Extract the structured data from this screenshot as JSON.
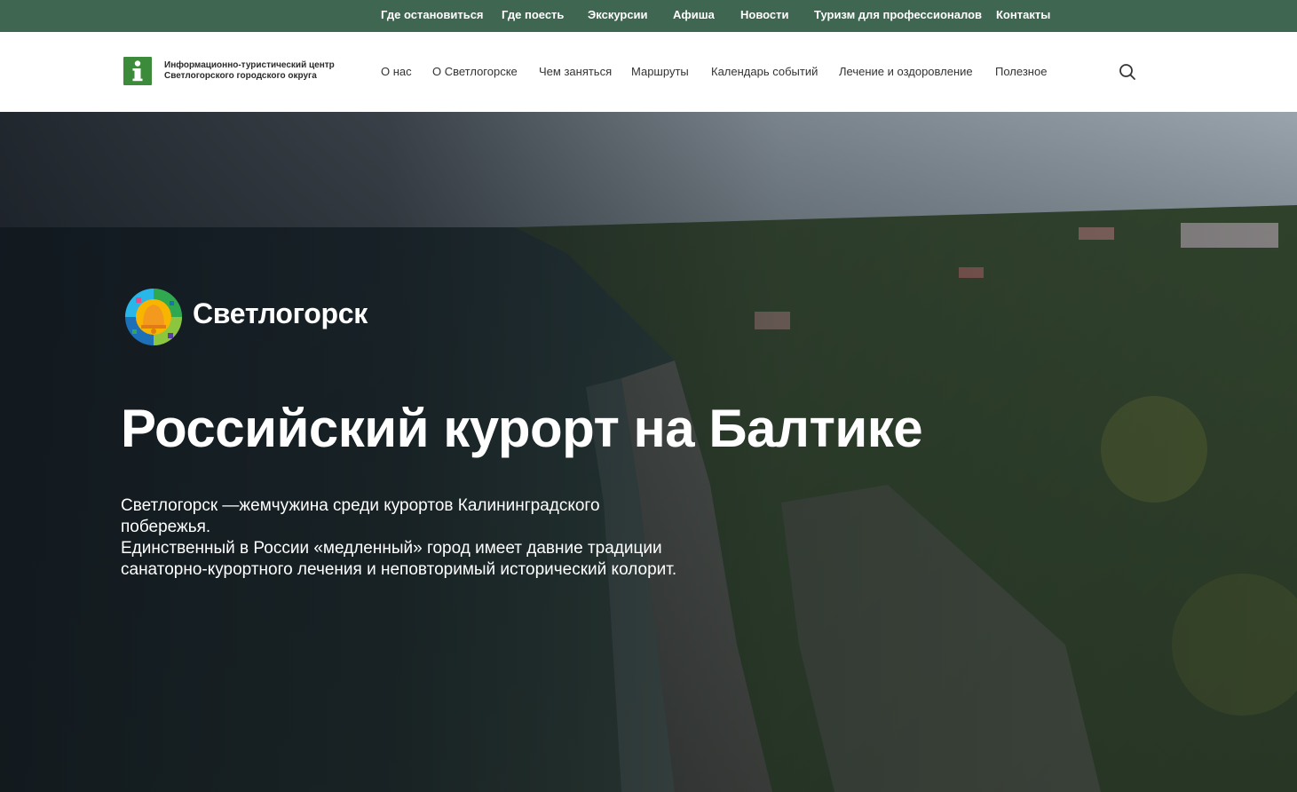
{
  "topbar": {
    "links": [
      "Где остановиться",
      "Где поесть",
      "Экскурсии",
      "Афиша",
      "Новости",
      "Туризм для профессионалов",
      "Контакты"
    ]
  },
  "header": {
    "org_name_line1": "Информационно-туристический центр",
    "org_name_line2": "Светлогорского городского округа",
    "logo_icon": "info-letter-i",
    "nav": [
      "О нас",
      "О Светлогорске",
      "Чем заняться",
      "Маршруты",
      "Календарь событий",
      "Лечение и оздоровление",
      "Полезное"
    ],
    "search_icon": "magnifier"
  },
  "hero": {
    "brand_name": "Светлогорск",
    "title": "Российский курорт на Балтике",
    "description_lines": [
      "Светлогорск —жемчужина среди курортов Калининградского",
      "побережья.",
      "Единственный в России «медленный» город имеет давние традиции",
      "санаторно-курортного лечения и неповторимый исторический колорит."
    ]
  },
  "colors": {
    "topbar_bg": "#3f6651",
    "logo_green": "#3c8b3a",
    "header_bg": "#ffffff",
    "hero_text": "#ffffff"
  }
}
